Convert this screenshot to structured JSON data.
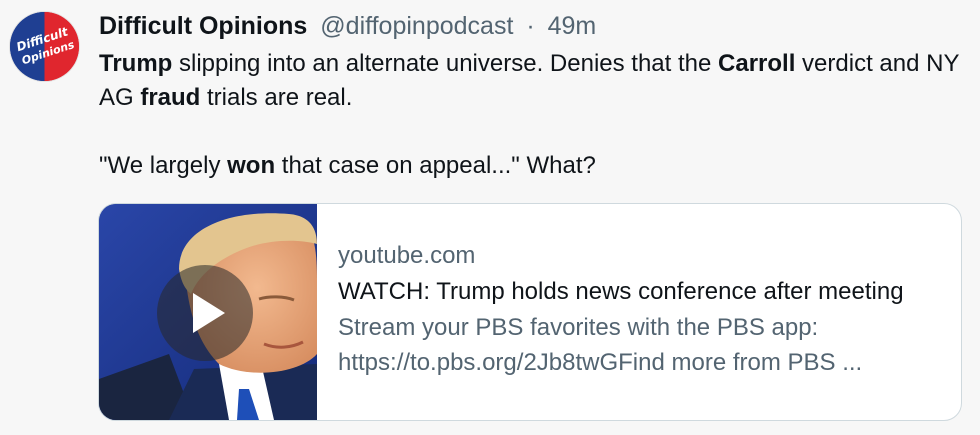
{
  "tweet": {
    "author_name": "Difficult Opinions",
    "handle": "@diffopinpodcast",
    "separator": "·",
    "time": "49m",
    "avatar_text_line1": "Difficult",
    "avatar_text_line2": "Opinions",
    "body_p1": [
      {
        "text": "Trump",
        "bold": true
      },
      {
        "text": " slipping into an alternate universe. Denies that the ",
        "bold": false
      },
      {
        "text": "Carroll",
        "bold": true
      },
      {
        "text": " verdict and NY AG ",
        "bold": false
      },
      {
        "text": "fraud",
        "bold": true
      },
      {
        "text": " trials are real.",
        "bold": false
      }
    ],
    "body_p2": [
      {
        "text": "\"We largely ",
        "bold": false
      },
      {
        "text": "won",
        "bold": true
      },
      {
        "text": " that case on appeal...\"  What?",
        "bold": false
      }
    ]
  },
  "card": {
    "domain": "youtube.com",
    "title": "WATCH: Trump holds news conference after meeting",
    "description_line1": "Stream your PBS favorites with the PBS app:",
    "description_line2": "https://to.pbs.org/2Jb8twGFind more from PBS ..."
  },
  "colors": {
    "text_primary": "#0f1419",
    "text_secondary": "#536471",
    "card_border": "#cfd9de",
    "avatar_blue": "#1f3f92",
    "avatar_red": "#e0262e"
  }
}
